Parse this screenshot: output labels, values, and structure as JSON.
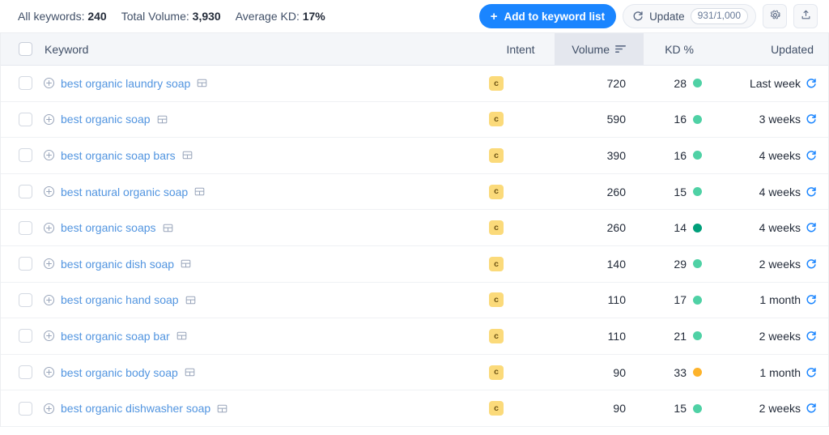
{
  "toolbar": {
    "summary": [
      {
        "label": "All keywords:",
        "value": "240"
      },
      {
        "label": "Total Volume:",
        "value": "3,930"
      },
      {
        "label": "Average KD:",
        "value": "17%"
      }
    ],
    "add_to_list_label": "Add to keyword list",
    "add_to_list_plus": "+",
    "update_label": "Update",
    "update_quota": "931/1,000",
    "settings_icon": "gear-icon",
    "export_icon": "upload-icon"
  },
  "table": {
    "columns": {
      "keyword": "Keyword",
      "intent": "Intent",
      "volume": "Volume",
      "kd": "KD %",
      "updated": "Updated"
    },
    "sorted_column": "volume",
    "sort_direction": "desc",
    "rows": [
      {
        "keyword": "best organic laundry soap",
        "intent": "C",
        "volume": "720",
        "kd": "28",
        "kd_color": "#4fd1a5",
        "updated": "Last week"
      },
      {
        "keyword": "best organic soap",
        "intent": "C",
        "volume": "590",
        "kd": "16",
        "kd_color": "#4fd1a5",
        "updated": "3 weeks"
      },
      {
        "keyword": "best organic soap bars",
        "intent": "C",
        "volume": "390",
        "kd": "16",
        "kd_color": "#4fd1a5",
        "updated": "4 weeks"
      },
      {
        "keyword": "best natural organic soap",
        "intent": "C",
        "volume": "260",
        "kd": "15",
        "kd_color": "#4fd1a5",
        "updated": "4 weeks"
      },
      {
        "keyword": "best organic soaps",
        "intent": "C",
        "volume": "260",
        "kd": "14",
        "kd_color": "#009f7a",
        "updated": "4 weeks"
      },
      {
        "keyword": "best organic dish soap",
        "intent": "C",
        "volume": "140",
        "kd": "29",
        "kd_color": "#4fd1a5",
        "updated": "2 weeks"
      },
      {
        "keyword": "best organic hand soap",
        "intent": "C",
        "volume": "110",
        "kd": "17",
        "kd_color": "#4fd1a5",
        "updated": "1 month"
      },
      {
        "keyword": "best organic soap bar",
        "intent": "C",
        "volume": "110",
        "kd": "21",
        "kd_color": "#4fd1a5",
        "updated": "2 weeks"
      },
      {
        "keyword": "best organic body soap",
        "intent": "C",
        "volume": "90",
        "kd": "33",
        "kd_color": "#fdb32b",
        "updated": "1 month"
      },
      {
        "keyword": "best organic dishwasher soap",
        "intent": "C",
        "volume": "90",
        "kd": "15",
        "kd_color": "#4fd1a5",
        "updated": "2 weeks"
      }
    ]
  },
  "colors": {
    "accent_blue": "#1a85ff",
    "link_blue": "#5295e0",
    "intent_commercial_bg": "#fbda7a",
    "kd_easy": "#4fd1a5",
    "kd_very_easy": "#009f7a",
    "kd_medium": "#fdb32b"
  }
}
